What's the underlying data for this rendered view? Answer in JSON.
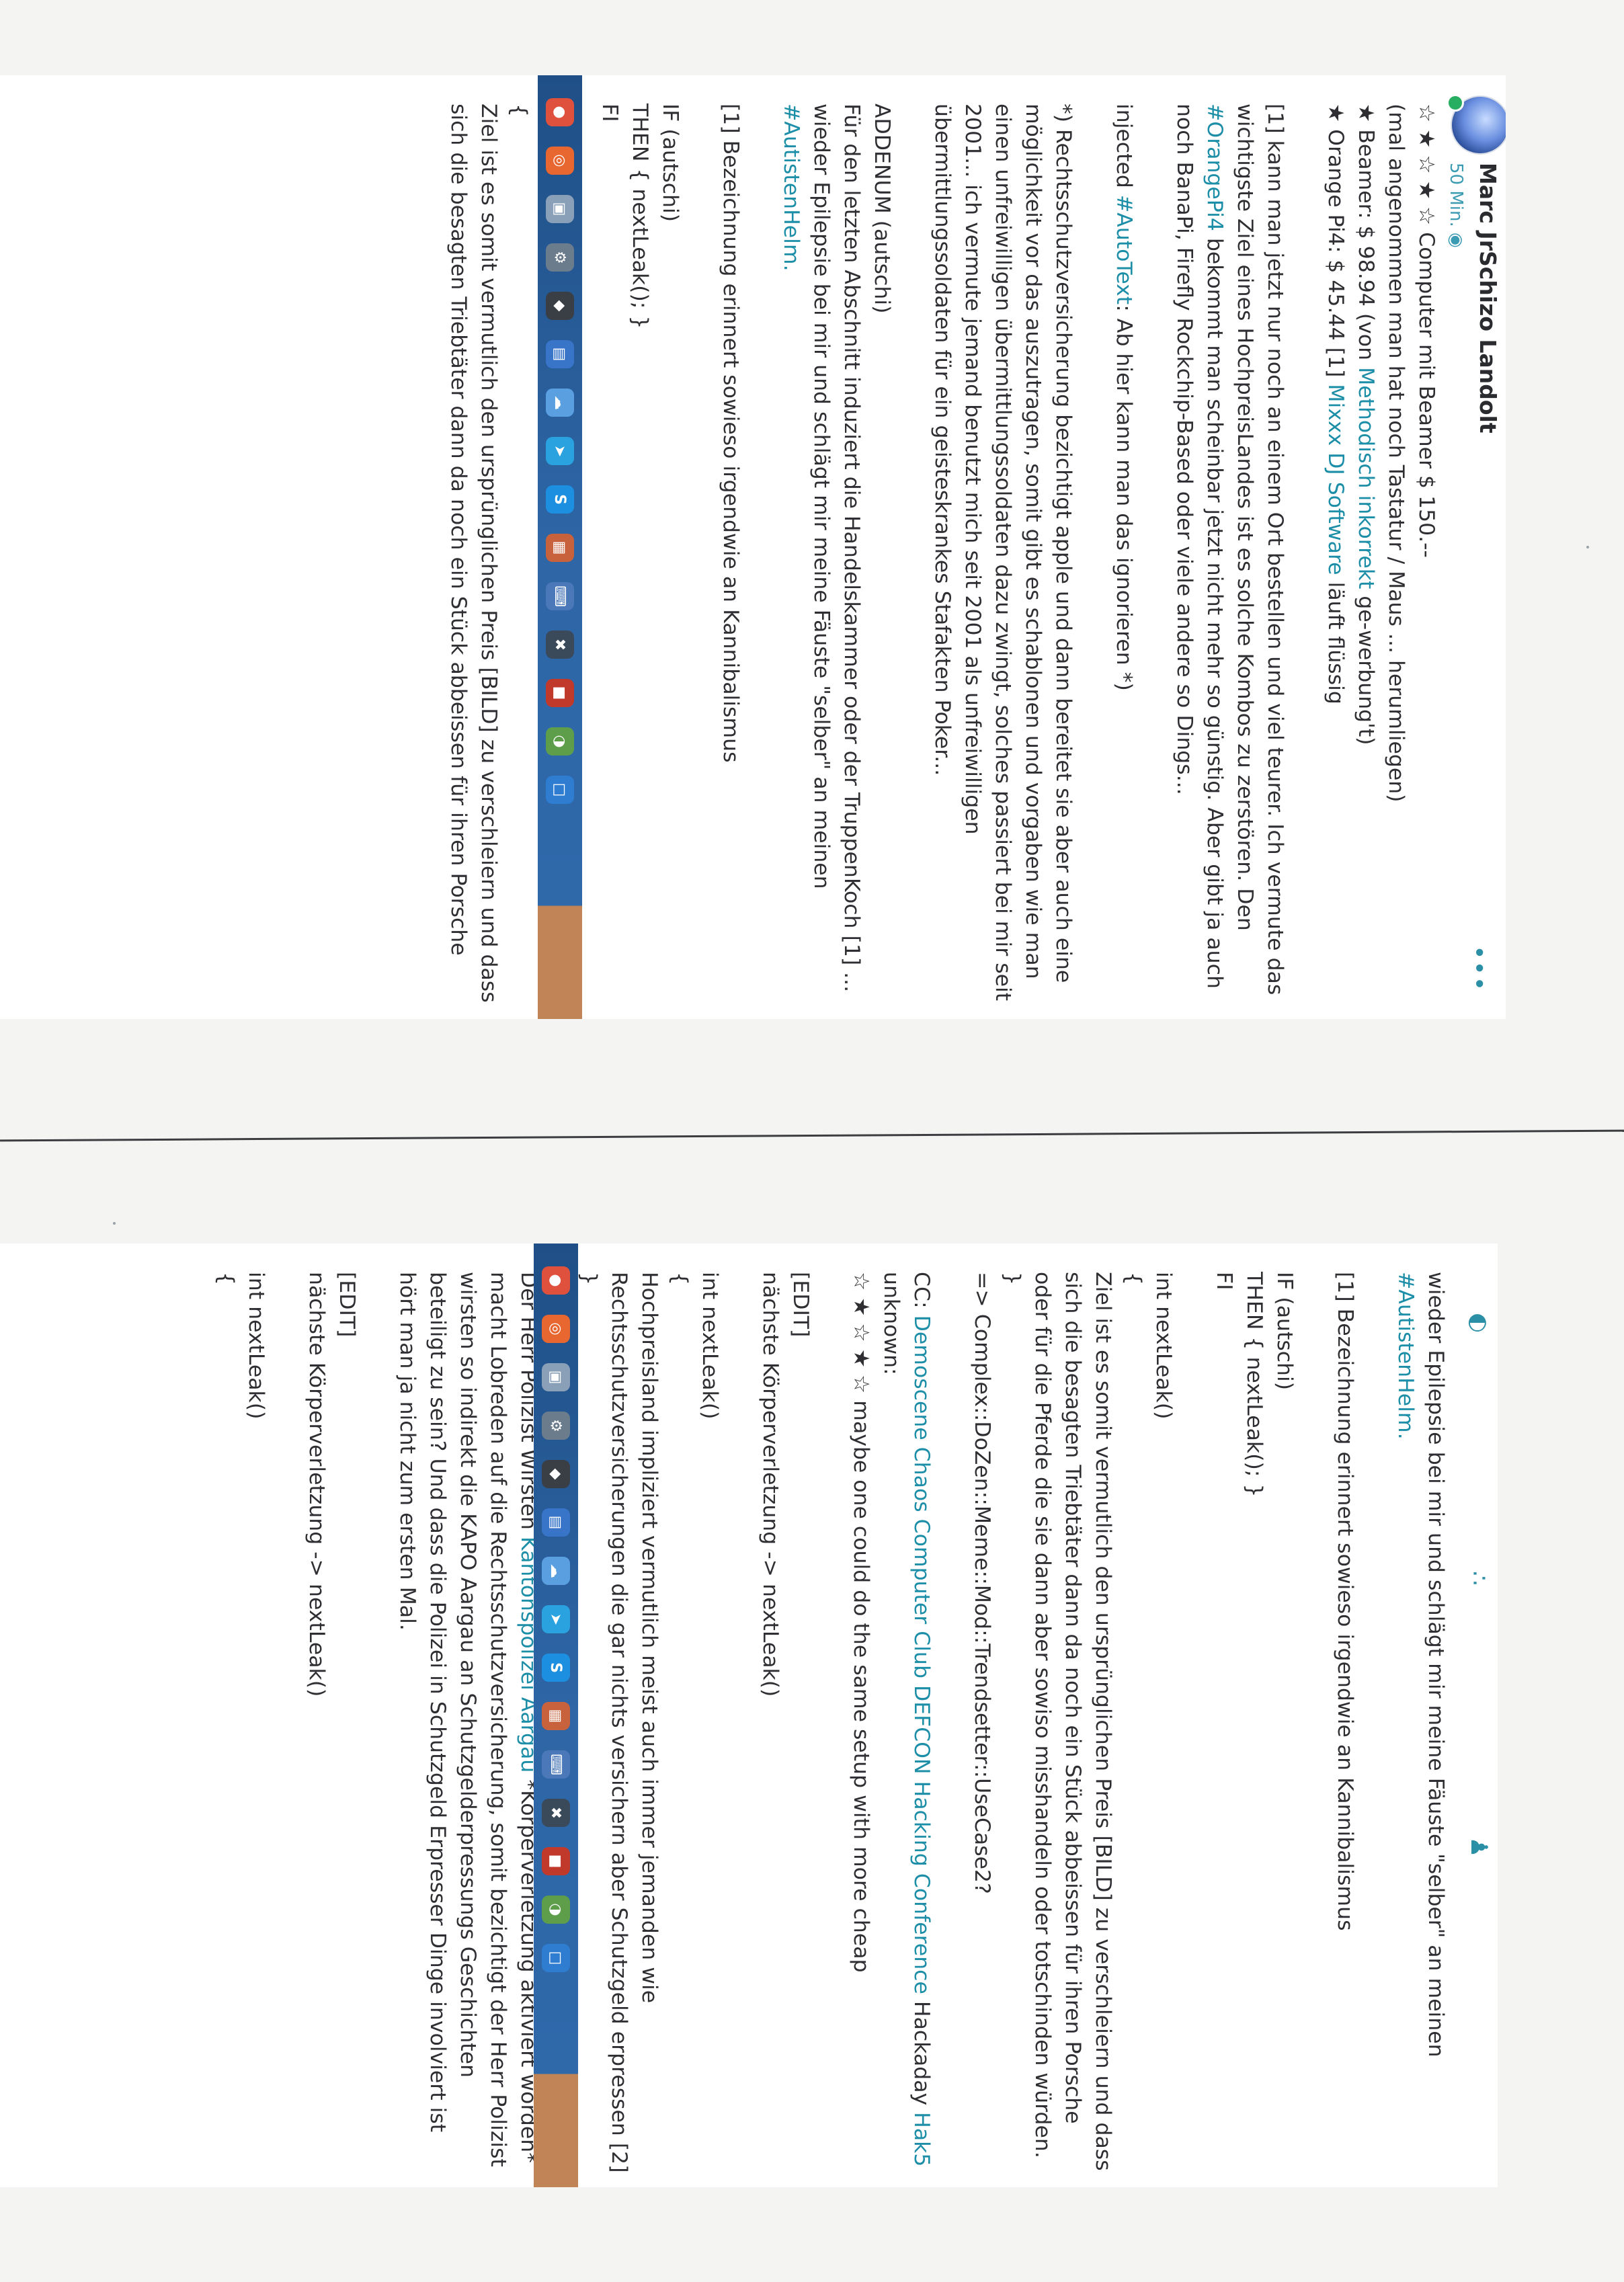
{
  "post1": {
    "author": "Marc JrSchizo Landolt",
    "time": "50 Min.",
    "globe_icon": "globe-icon",
    "more_label": "•••",
    "lines": [
      [
        {
          "t": "☆ ★ ☆ ★ ☆ Computer mit Beamer $ 150.--"
        }
      ],
      [
        {
          "t": "(mal angenommen man hat noch Tastatur / Maus ... herumliegen)"
        }
      ],
      [
        {
          "t": "★ Beamer: $ 98.94 (von "
        },
        {
          "t": "Methodisch inkorrekt",
          "tag": true
        },
        {
          "t": " ge-werbung't)"
        }
      ],
      [
        {
          "t": "★ Orange Pi4: $ 45.44 [1] "
        },
        {
          "t": "Mixxx DJ Software",
          "tag": true
        },
        {
          "t": " läuft flüssig"
        }
      ],
      [
        {
          "t": ""
        }
      ],
      [
        {
          "t": "[1] kann man jetzt nur noch an einem Ort bestellen und viel teurer. Ich vermute das"
        }
      ],
      [
        {
          "t": "wichtigste Ziel eines HochpreisLandes ist es solche Kombos zu zerstören. Den"
        }
      ],
      [
        {
          "t": "#OrangePi4",
          "tag": true
        },
        {
          "t": " bekommt man scheinbar jetzt nicht mehr so günstig. Aber gibt ja auch"
        }
      ],
      [
        {
          "t": "noch BanaPi, Firefly Rockchip-Based oder viele andere so Dings..."
        }
      ],
      [
        {
          "t": ""
        }
      ],
      [
        {
          "t": "injected "
        },
        {
          "t": "#AutoText",
          "tag": true
        },
        {
          "t": ": Ab hier kann man das ignorieren *)"
        }
      ],
      [
        {
          "t": ""
        }
      ],
      [
        {
          "t": "*) Rechtsschutzversicherung bezichtigt apple und dann bereitet sie aber auch eine"
        }
      ],
      [
        {
          "t": "möglichkeit vor das auszutragen, somit gibt es schablonen und vorgaben wie man"
        }
      ],
      [
        {
          "t": "einen unfreiwilligen übermittlungssoldaten dazu zwingt, solches passiert bei mir seit"
        }
      ],
      [
        {
          "t": "2001... ich vermute jemand benutzt mich seit 2001 als unfreiwilligen"
        }
      ],
      [
        {
          "t": "übermittlungssoldaten für ein geisteskrankes Stafakten Poker..."
        }
      ],
      [
        {
          "t": ""
        }
      ],
      [
        {
          "t": "ADDENUM (autschi)"
        }
      ],
      [
        {
          "t": "Für den letzten Abschnitt induziert die Handelskammer oder der TruppenKoch [1] ..."
        }
      ],
      [
        {
          "t": "wieder Epilepsie bei mir und schlägt mir meine Fäuste \"selber\" an meinen"
        }
      ],
      [
        {
          "t": "#AutistenHelm.",
          "tag": true
        }
      ],
      [
        {
          "t": ""
        }
      ],
      [
        {
          "t": "[1] Bezeichnung erinnert sowieso irgendwie an Kannibalismus"
        }
      ],
      [
        {
          "t": ""
        }
      ],
      [
        {
          "t": "IF (autschi)"
        }
      ],
      [
        {
          "t": "THEN { nextLeak(); }"
        }
      ],
      [
        {
          "t": "FI"
        }
      ],
      [
        {
          "t": ""
        }
      ],
      [
        {
          "t": "int nextLeak()"
        }
      ],
      [
        {
          "t": "{"
        }
      ],
      [
        {
          "t": "Ziel ist es somit vermutlich den ursprünglichen Preis [BILD] zu verschleiern und dass"
        }
      ],
      [
        {
          "t": "sich die besagten Triebtäter dann da noch ein Stück abbeissen für ihren Porsche"
        }
      ]
    ],
    "taskbar_icons": [
      {
        "name": "chrome-icon",
        "glyph": "●",
        "color": "#e0513d"
      },
      {
        "name": "ubuntu-icon",
        "glyph": "◎",
        "color": "#e8662f"
      },
      {
        "name": "files-icon",
        "glyph": "▣",
        "color": "#8aa0b8"
      },
      {
        "name": "settings-icon",
        "glyph": "⚙",
        "color": "#6b7c8c"
      },
      {
        "name": "inkscape-icon",
        "glyph": "◆",
        "color": "#3a3f46"
      },
      {
        "name": "libreoffice-icon",
        "glyph": "▤",
        "color": "#3874c8"
      },
      {
        "name": "weather-icon",
        "glyph": "☁",
        "color": "#5aa0e0"
      },
      {
        "name": "telegram-icon",
        "glyph": "➤",
        "color": "#2aa2df"
      },
      {
        "name": "skype-icon",
        "glyph": "S",
        "color": "#1d8fe0"
      },
      {
        "name": "grid-app-icon",
        "glyph": "▦",
        "color": "#c7623d"
      },
      {
        "name": "keyboard-icon",
        "glyph": "⌨",
        "color": "#4a78b8"
      },
      {
        "name": "network-icon",
        "glyph": "✖",
        "color": "#3a4a5a"
      },
      {
        "name": "stream-app-icon",
        "glyph": "■",
        "color": "#c0392b"
      },
      {
        "name": "music-app-icon",
        "glyph": "◑",
        "color": "#5e9e4a"
      },
      {
        "name": "window-app-icon",
        "glyph": "□",
        "color": "#2e7dd1"
      }
    ]
  },
  "post2": {
    "top_icons": [
      {
        "name": "contrast-icon",
        "glyph": "◐"
      },
      {
        "name": "glasses-icon",
        "glyph": "∴"
      },
      {
        "name": "person-icon",
        "glyph": "♟"
      }
    ],
    "lines": [
      [
        {
          "t": "wieder Epilepsie bei mir und schlägt mir meine Fäuste \"selber\" an meinen"
        }
      ],
      [
        {
          "t": "#AutistenHelm.",
          "tag": true
        }
      ],
      [
        {
          "t": ""
        }
      ],
      [
        {
          "t": "[1] Bezeichnung erinnert sowieso irgendwie an Kannibalismus"
        }
      ],
      [
        {
          "t": ""
        }
      ],
      [
        {
          "t": "IF (autschi)"
        }
      ],
      [
        {
          "t": "THEN { nextLeak(); }"
        }
      ],
      [
        {
          "t": "FI"
        }
      ],
      [
        {
          "t": ""
        }
      ],
      [
        {
          "t": "int nextLeak()"
        }
      ],
      [
        {
          "t": "{"
        }
      ],
      [
        {
          "t": "Ziel ist es somit vermutlich den ursprünglichen Preis [BILD] zu verschleiern und dass"
        }
      ],
      [
        {
          "t": "sich die besagten Triebtäter dann da noch ein Stück abbeissen für ihren Porsche"
        }
      ],
      [
        {
          "t": "oder für die Pferde die sie dann aber sowiso misshandeln oder totschinden würden."
        }
      ],
      [
        {
          "t": "}"
        }
      ],
      [
        {
          "t": "=> Complex::DoZen::Meme::Mod::Trendsetter::UseCase2?"
        }
      ],
      [
        {
          "t": ""
        }
      ],
      [
        {
          "t": "CC: "
        },
        {
          "t": "Demoscene Chaos Computer Club DEFCON Hacking Conference",
          "tag": true
        },
        {
          "t": " Hackaday "
        },
        {
          "t": "Hak5",
          "tag": true
        }
      ],
      [
        {
          "t": "unknown:"
        }
      ],
      [
        {
          "t": "☆ ★ ☆ ★ ☆  maybe one could do the same setup with more cheap"
        }
      ],
      [
        {
          "t": ""
        }
      ],
      [
        {
          "t": "[EDIT]"
        }
      ],
      [
        {
          "t": "nächste Körperverletzung -> nextLeak()"
        }
      ],
      [
        {
          "t": ""
        }
      ],
      [
        {
          "t": "int nextLeak()"
        }
      ],
      [
        {
          "t": "{"
        }
      ],
      [
        {
          "t": "Hochpreisland impliziert vermutlich meist auch immer jemanden wie"
        }
      ],
      [
        {
          "t": "Rechtsschutzversicherungen die gar nichts versichern aber Schutzgeld erpressen [2]"
        }
      ],
      [
        {
          "t": "}"
        }
      ],
      [
        {
          "t": ""
        }
      ],
      [
        {
          "t": "Der Herr Polizist Wirsten "
        },
        {
          "t": "Kantonspolizei Aargau",
          "tag": true
        },
        {
          "t": " *Körperverletzung aktiviert worden*"
        }
      ],
      [
        {
          "t": "macht Lobreden auf die Rechtsschutzversicherung, somit bezichtigt der Herr Polizist"
        }
      ],
      [
        {
          "t": "wirsten so indirekt die KAPO Aargau an Schutzgelderpressungs Geschichten"
        }
      ],
      [
        {
          "t": "beteiligt zu sein? Und dass die Polizei in Schutzgeld Erpresser Dinge involviert ist"
        }
      ],
      [
        {
          "t": "hört man ja nicht zum ersten Mal."
        }
      ],
      [
        {
          "t": ""
        }
      ],
      [
        {
          "t": "[EDIT]"
        }
      ],
      [
        {
          "t": "nächste Körperverletzung -> nextLeak()"
        }
      ],
      [
        {
          "t": ""
        }
      ],
      [
        {
          "t": "int nextLeak()"
        }
      ],
      [
        {
          "t": "{"
        }
      ]
    ],
    "taskbar_icons": [
      {
        "name": "chrome-icon",
        "glyph": "●",
        "color": "#e0513d"
      },
      {
        "name": "ubuntu-icon",
        "glyph": "◎",
        "color": "#e8662f"
      },
      {
        "name": "files-icon",
        "glyph": "▣",
        "color": "#8aa0b8"
      },
      {
        "name": "settings-icon",
        "glyph": "⚙",
        "color": "#6b7c8c"
      },
      {
        "name": "inkscape-icon",
        "glyph": "◆",
        "color": "#3a3f46"
      },
      {
        "name": "libreoffice-icon",
        "glyph": "▤",
        "color": "#3874c8"
      },
      {
        "name": "weather-icon",
        "glyph": "☁",
        "color": "#5aa0e0"
      },
      {
        "name": "telegram-icon",
        "glyph": "➤",
        "color": "#2aa2df"
      },
      {
        "name": "skype-icon",
        "glyph": "S",
        "color": "#1d8fe0"
      },
      {
        "name": "grid-app-icon",
        "glyph": "▦",
        "color": "#c7623d"
      },
      {
        "name": "keyboard-icon",
        "glyph": "⌨",
        "color": "#4a78b8"
      },
      {
        "name": "network-icon",
        "glyph": "✖",
        "color": "#3a4a5a"
      },
      {
        "name": "stream-app-icon",
        "glyph": "■",
        "color": "#c0392b"
      },
      {
        "name": "music-app-icon",
        "glyph": "◑",
        "color": "#5e9e4a"
      },
      {
        "name": "window-app-icon",
        "glyph": "□",
        "color": "#2e7dd1"
      }
    ]
  }
}
